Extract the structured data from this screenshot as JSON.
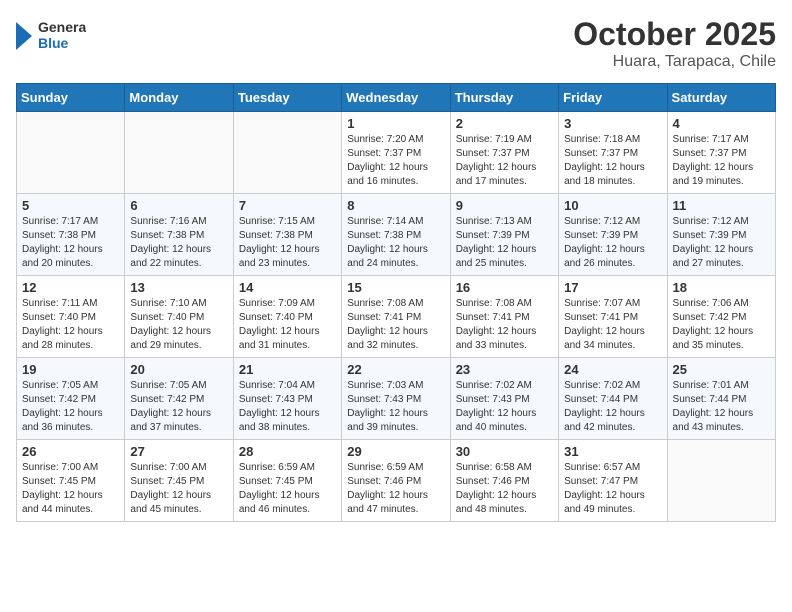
{
  "logo": {
    "general": "General",
    "blue": "Blue"
  },
  "header": {
    "month": "October 2025",
    "location": "Huara, Tarapaca, Chile"
  },
  "weekdays": [
    "Sunday",
    "Monday",
    "Tuesday",
    "Wednesday",
    "Thursday",
    "Friday",
    "Saturday"
  ],
  "weeks": [
    [
      {
        "day": "",
        "info": ""
      },
      {
        "day": "",
        "info": ""
      },
      {
        "day": "",
        "info": ""
      },
      {
        "day": "1",
        "info": "Sunrise: 7:20 AM\nSunset: 7:37 PM\nDaylight: 12 hours and 16 minutes."
      },
      {
        "day": "2",
        "info": "Sunrise: 7:19 AM\nSunset: 7:37 PM\nDaylight: 12 hours and 17 minutes."
      },
      {
        "day": "3",
        "info": "Sunrise: 7:18 AM\nSunset: 7:37 PM\nDaylight: 12 hours and 18 minutes."
      },
      {
        "day": "4",
        "info": "Sunrise: 7:17 AM\nSunset: 7:37 PM\nDaylight: 12 hours and 19 minutes."
      }
    ],
    [
      {
        "day": "5",
        "info": "Sunrise: 7:17 AM\nSunset: 7:38 PM\nDaylight: 12 hours and 20 minutes."
      },
      {
        "day": "6",
        "info": "Sunrise: 7:16 AM\nSunset: 7:38 PM\nDaylight: 12 hours and 22 minutes."
      },
      {
        "day": "7",
        "info": "Sunrise: 7:15 AM\nSunset: 7:38 PM\nDaylight: 12 hours and 23 minutes."
      },
      {
        "day": "8",
        "info": "Sunrise: 7:14 AM\nSunset: 7:38 PM\nDaylight: 12 hours and 24 minutes."
      },
      {
        "day": "9",
        "info": "Sunrise: 7:13 AM\nSunset: 7:39 PM\nDaylight: 12 hours and 25 minutes."
      },
      {
        "day": "10",
        "info": "Sunrise: 7:12 AM\nSunset: 7:39 PM\nDaylight: 12 hours and 26 minutes."
      },
      {
        "day": "11",
        "info": "Sunrise: 7:12 AM\nSunset: 7:39 PM\nDaylight: 12 hours and 27 minutes."
      }
    ],
    [
      {
        "day": "12",
        "info": "Sunrise: 7:11 AM\nSunset: 7:40 PM\nDaylight: 12 hours and 28 minutes."
      },
      {
        "day": "13",
        "info": "Sunrise: 7:10 AM\nSunset: 7:40 PM\nDaylight: 12 hours and 29 minutes."
      },
      {
        "day": "14",
        "info": "Sunrise: 7:09 AM\nSunset: 7:40 PM\nDaylight: 12 hours and 31 minutes."
      },
      {
        "day": "15",
        "info": "Sunrise: 7:08 AM\nSunset: 7:41 PM\nDaylight: 12 hours and 32 minutes."
      },
      {
        "day": "16",
        "info": "Sunrise: 7:08 AM\nSunset: 7:41 PM\nDaylight: 12 hours and 33 minutes."
      },
      {
        "day": "17",
        "info": "Sunrise: 7:07 AM\nSunset: 7:41 PM\nDaylight: 12 hours and 34 minutes."
      },
      {
        "day": "18",
        "info": "Sunrise: 7:06 AM\nSunset: 7:42 PM\nDaylight: 12 hours and 35 minutes."
      }
    ],
    [
      {
        "day": "19",
        "info": "Sunrise: 7:05 AM\nSunset: 7:42 PM\nDaylight: 12 hours and 36 minutes."
      },
      {
        "day": "20",
        "info": "Sunrise: 7:05 AM\nSunset: 7:42 PM\nDaylight: 12 hours and 37 minutes."
      },
      {
        "day": "21",
        "info": "Sunrise: 7:04 AM\nSunset: 7:43 PM\nDaylight: 12 hours and 38 minutes."
      },
      {
        "day": "22",
        "info": "Sunrise: 7:03 AM\nSunset: 7:43 PM\nDaylight: 12 hours and 39 minutes."
      },
      {
        "day": "23",
        "info": "Sunrise: 7:02 AM\nSunset: 7:43 PM\nDaylight: 12 hours and 40 minutes."
      },
      {
        "day": "24",
        "info": "Sunrise: 7:02 AM\nSunset: 7:44 PM\nDaylight: 12 hours and 42 minutes."
      },
      {
        "day": "25",
        "info": "Sunrise: 7:01 AM\nSunset: 7:44 PM\nDaylight: 12 hours and 43 minutes."
      }
    ],
    [
      {
        "day": "26",
        "info": "Sunrise: 7:00 AM\nSunset: 7:45 PM\nDaylight: 12 hours and 44 minutes."
      },
      {
        "day": "27",
        "info": "Sunrise: 7:00 AM\nSunset: 7:45 PM\nDaylight: 12 hours and 45 minutes."
      },
      {
        "day": "28",
        "info": "Sunrise: 6:59 AM\nSunset: 7:45 PM\nDaylight: 12 hours and 46 minutes."
      },
      {
        "day": "29",
        "info": "Sunrise: 6:59 AM\nSunset: 7:46 PM\nDaylight: 12 hours and 47 minutes."
      },
      {
        "day": "30",
        "info": "Sunrise: 6:58 AM\nSunset: 7:46 PM\nDaylight: 12 hours and 48 minutes."
      },
      {
        "day": "31",
        "info": "Sunrise: 6:57 AM\nSunset: 7:47 PM\nDaylight: 12 hours and 49 minutes."
      },
      {
        "day": "",
        "info": ""
      }
    ]
  ]
}
